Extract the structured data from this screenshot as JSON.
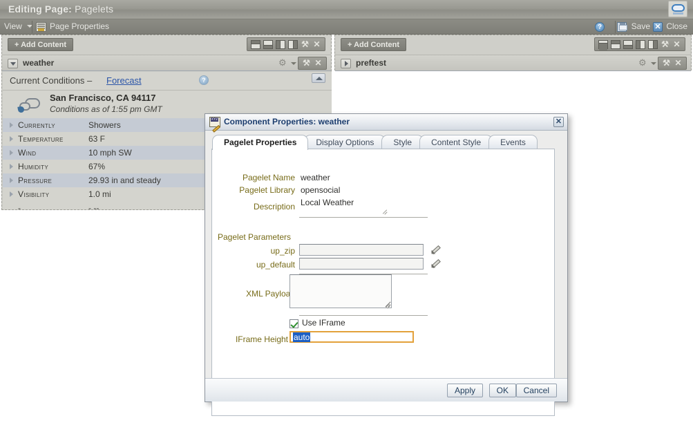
{
  "banner": {
    "title_prefix": "Editing Page:",
    "title_value": "Pagelets",
    "logo_name": "monitor-logo"
  },
  "menubar": {
    "view_label": "View",
    "page_properties_label": "Page Properties",
    "help_label": "?",
    "save_label": "Save",
    "close_label": "Close"
  },
  "left_column": {
    "add_content_label": "+ Add Content",
    "toolbar_icons": [
      "layout-split-top",
      "layout-split-bottom",
      "layout-split-left",
      "layout-split-right",
      "wrench",
      "close"
    ],
    "wrench_glyph": "⚒",
    "close_glyph": "✕",
    "portlet": {
      "title": "weather",
      "gear_glyph": "⚙",
      "expanded": true
    },
    "weather": {
      "current_conditions_label": "Current Conditions –",
      "forecast_link": "Forecast",
      "help_glyph": "?",
      "location": "San Francisco, CA 94117",
      "as_of": "Conditions as of 1:55 pm GMT",
      "rows": [
        {
          "label": "Currently",
          "value": "Showers"
        },
        {
          "label": "Temperature",
          "value": "63 F"
        },
        {
          "label": "Wind",
          "value": "10 mph SW"
        },
        {
          "label": "Humidity",
          "value": "67%"
        },
        {
          "label": "Pressure",
          "value": "29.93 in and steady"
        },
        {
          "label": "Visibility",
          "value": "1.0 mi"
        }
      ]
    }
  },
  "right_column": {
    "add_content_label": "+ Add Content",
    "toolbar_icons": [
      "layout-add-box",
      "layout-split-top",
      "layout-split-bottom",
      "layout-split-left",
      "layout-split-right",
      "wrench",
      "close"
    ],
    "wrench_glyph": "⚒",
    "close_glyph": "✕",
    "portlet": {
      "title": "preftest",
      "gear_glyph": "⚙",
      "expanded": false
    }
  },
  "dialog": {
    "title": "Component Properties: weather",
    "icon_name": "xyz-pencil-icon",
    "icon_text": "XYZ",
    "close_glyph": "✕",
    "tabs": [
      {
        "label": "Pagelet Properties",
        "active": true
      },
      {
        "label": "Display Options",
        "active": false
      },
      {
        "label": "Style",
        "active": false
      },
      {
        "label": "Content Style",
        "active": false
      },
      {
        "label": "Events",
        "active": false
      }
    ],
    "fields": {
      "pagelet_name_label": "Pagelet Name",
      "pagelet_name_value": "weather",
      "pagelet_library_label": "Pagelet Library",
      "pagelet_library_value": "opensocial",
      "description_label": "Description",
      "description_value": "Local Weather",
      "pagelet_parameters_label": "Pagelet Parameters",
      "up_zip_label": "up_zip",
      "up_zip_value": "",
      "up_default_label": "up_default",
      "up_default_value": "",
      "xml_payload_label": "XML Payload",
      "xml_payload_value": "",
      "use_iframe_label": "Use IFrame",
      "use_iframe_checked": true,
      "iframe_height_label": "IFrame Height",
      "iframe_height_value": "auto"
    },
    "buttons": {
      "apply_label": "Apply",
      "ok_label": "OK",
      "cancel_label": "Cancel"
    }
  },
  "colors": {
    "banner_gray": "#999992",
    "label_olive": "#776b18",
    "dialog_title_blue": "#1c3d6e",
    "link_blue": "#2b55a8",
    "focus_orange": "#e3a13a",
    "selection_blue": "#1c5fc4"
  }
}
